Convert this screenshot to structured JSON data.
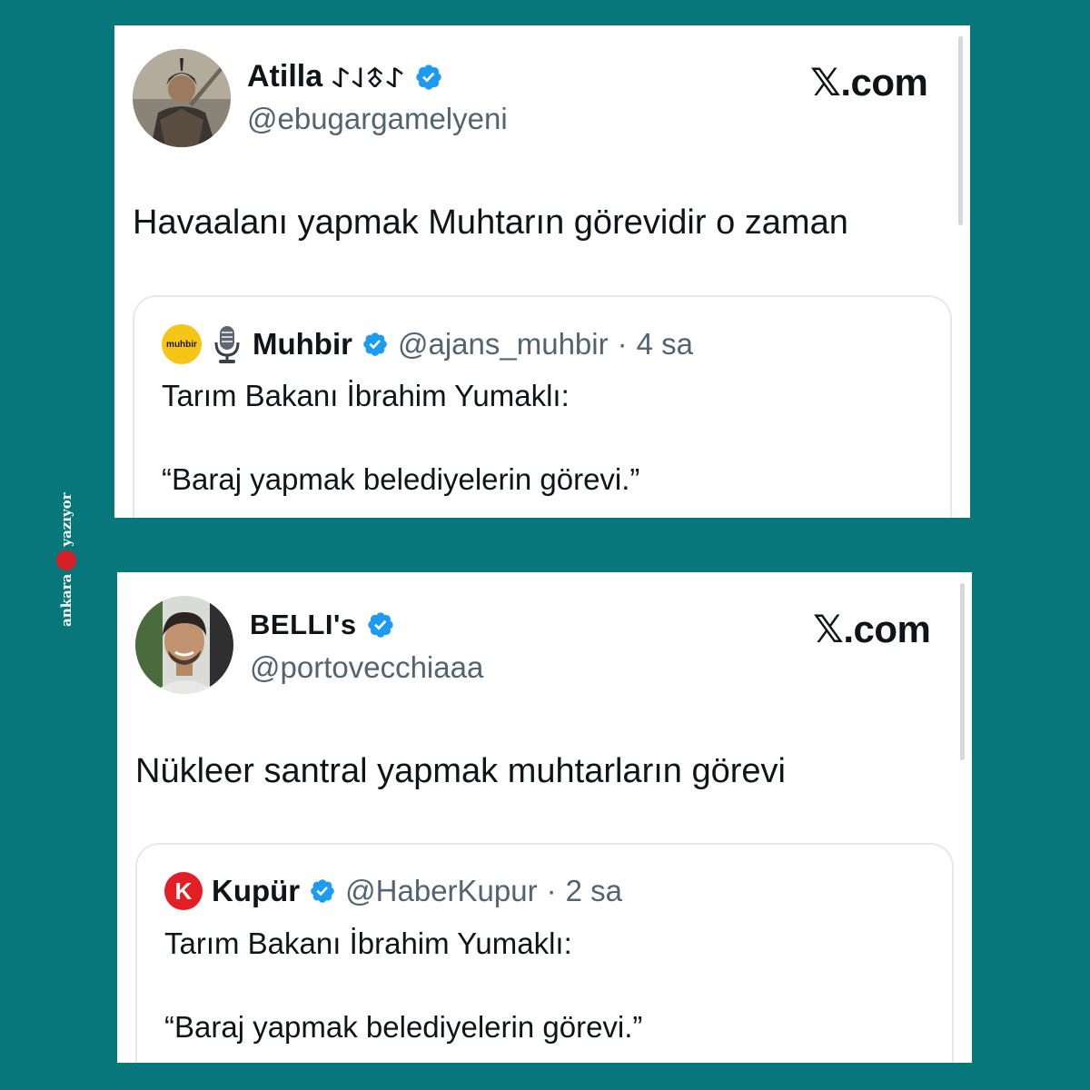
{
  "watermark": {
    "part1": "ankara",
    "part2": "yazıyor"
  },
  "tweets": [
    {
      "author_name": "Atilla",
      "author_runic": "𐰀𐱃𐰞𐰀",
      "handle": "@ebugargamelyeni",
      "site": "𝕏.com",
      "text": "Havaalanı yapmak Muhtarın görevidir o zaman",
      "quote": {
        "logo_text": "muhbir",
        "name": "Muhbir",
        "handle": "@ajans_muhbir",
        "separator": "·",
        "time": "4 sa",
        "line1": "Tarım Bakanı İbrahim Yumaklı:",
        "line2": "“Baraj yapmak belediyelerin görevi.”"
      }
    },
    {
      "author_name": "BELLI's",
      "handle": "@portovecchiaaa",
      "site": "𝕏.com",
      "text": "Nükleer santral yapmak muhtarların görevi",
      "quote": {
        "logo_text": "K",
        "name": "Kupür",
        "handle": "@HaberKupur",
        "separator": "·",
        "time": "2 sa",
        "line1": "Tarım Bakanı İbrahim Yumaklı:",
        "line2": "“Baraj yapmak belediyelerin görevi.”"
      }
    }
  ],
  "colors": {
    "background": "#07777b",
    "verified": "#1d9bf0",
    "secondary_text": "#536471"
  }
}
